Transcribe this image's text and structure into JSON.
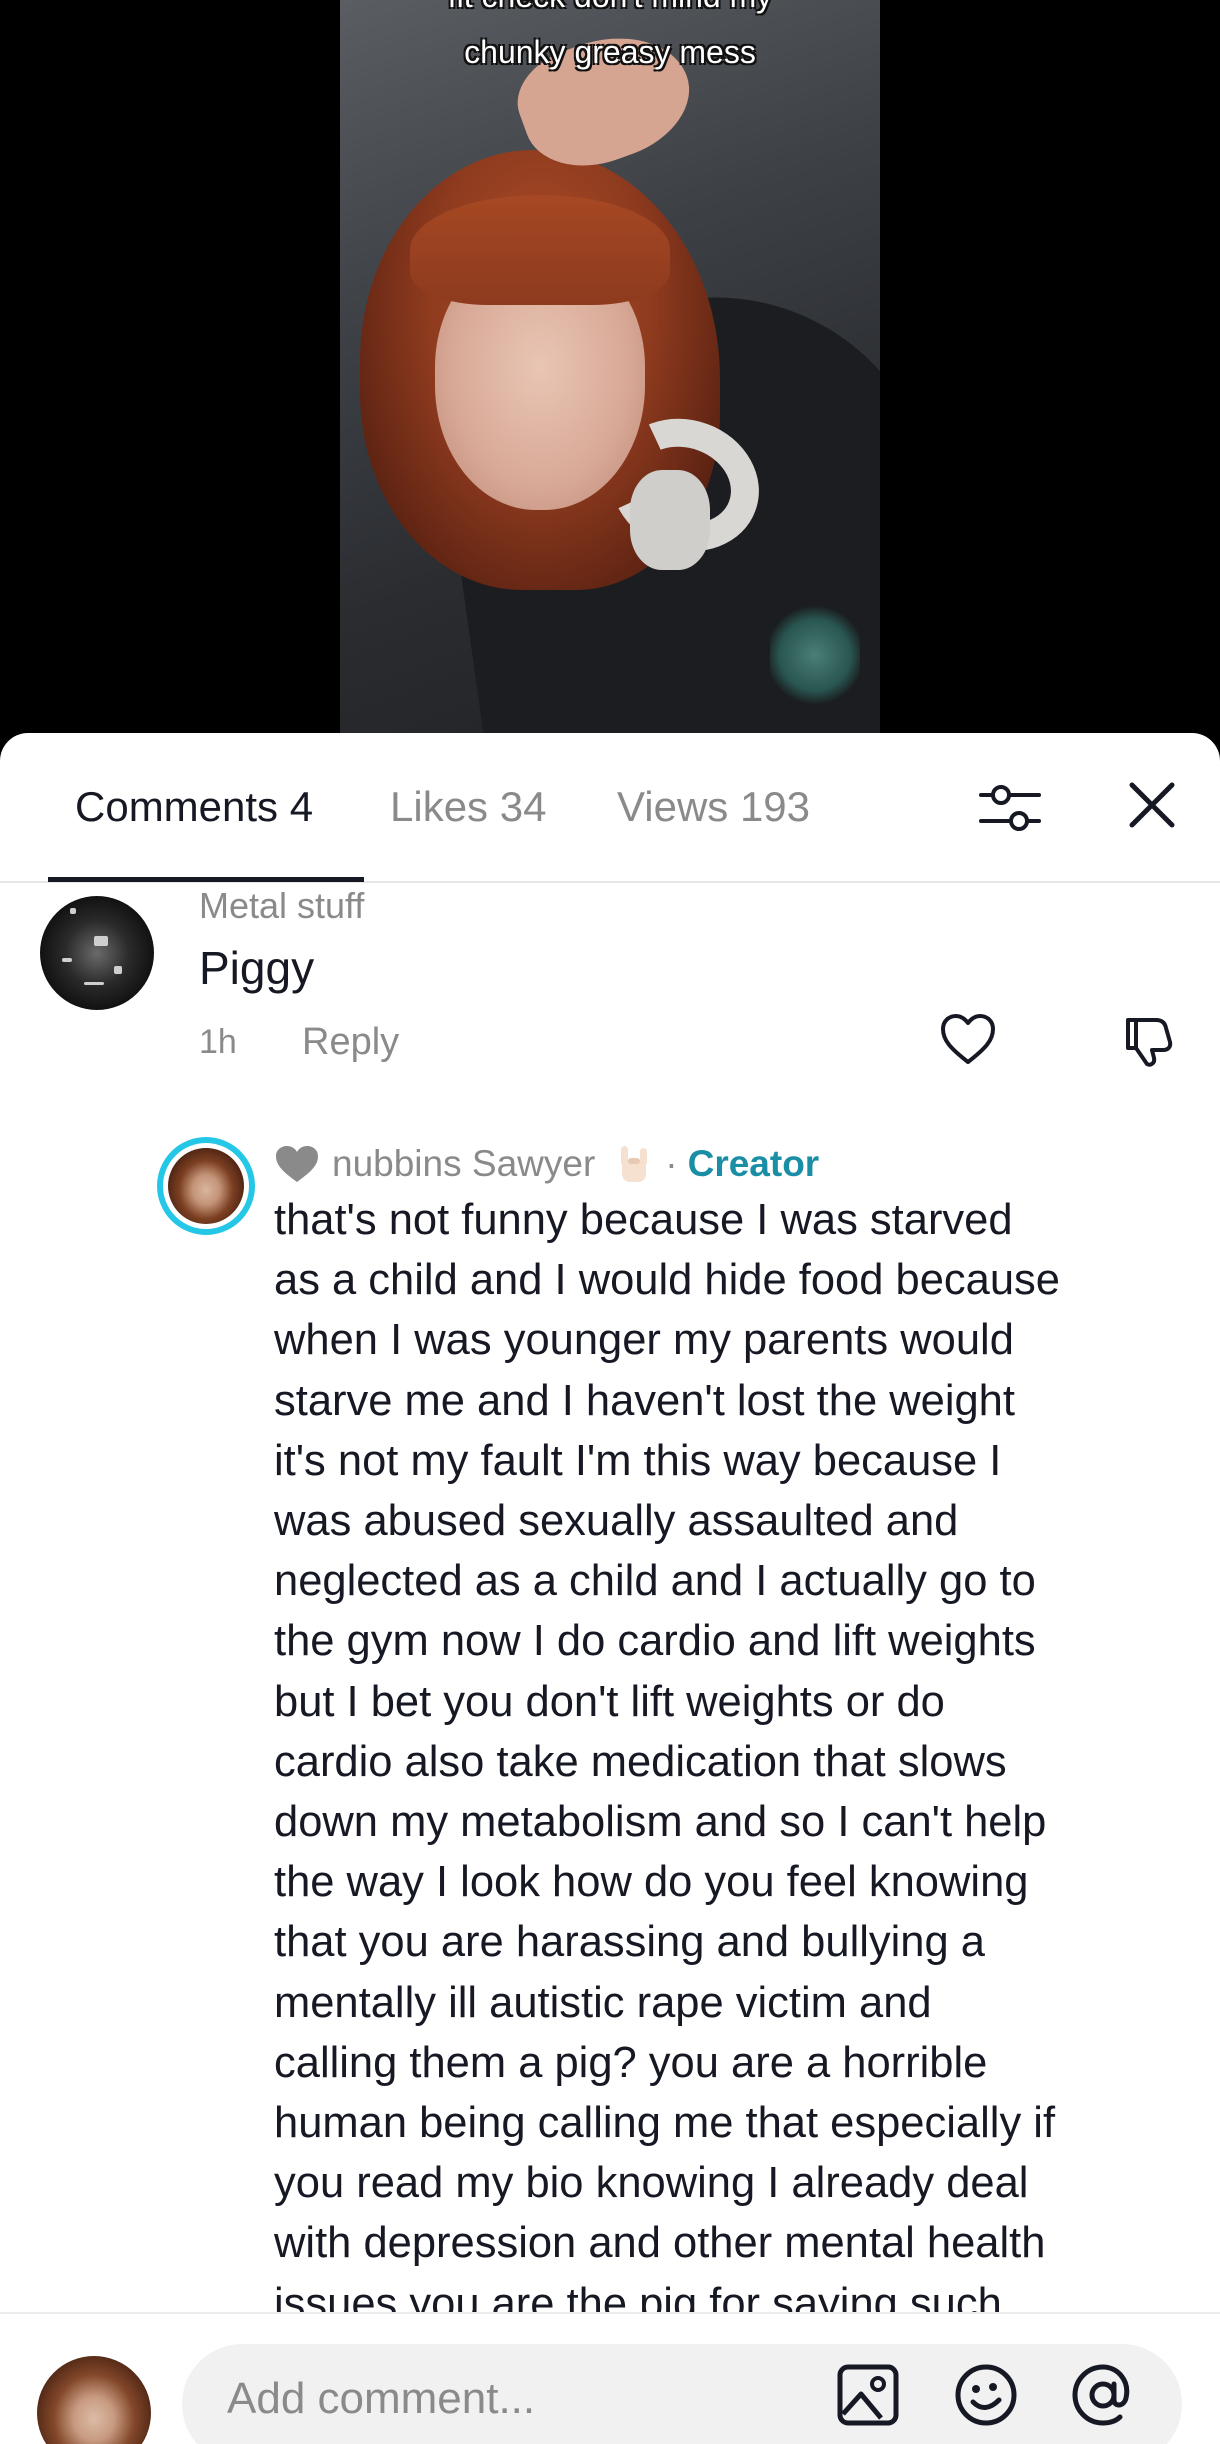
{
  "video": {
    "overlay_line1": "fit check don't mind my",
    "overlay_line2": "chunky greasy mess"
  },
  "tabs": {
    "comments": "Comments 4",
    "likes": "Likes 34",
    "views": "Views 193"
  },
  "icons": {
    "filter": "sliders-icon",
    "close": "close-icon",
    "like": "heart-outline-icon",
    "dislike": "thumbs-down-icon",
    "creator_heart": "heart-filled-icon",
    "horns": "rock-on-hand-emoji",
    "image": "image-icon",
    "emoji": "emoji-icon",
    "mention": "at-sign-icon"
  },
  "comment": {
    "username": "Metal stuff",
    "text": "Piggy",
    "time": "1h",
    "reply_label": "Reply"
  },
  "reply": {
    "username": "nubbins Sawyer",
    "separator": "·",
    "creator_label": "Creator",
    "lines": [
      "that's not funny because I was starved",
      "as a child and I would hide food because",
      "when I was younger my parents would",
      "starve me and I haven't lost the weight",
      "it's not my fault I'm this way because I",
      "was abused sexually assaulted and",
      "neglected as a child and I actually go to",
      "the gym now I do cardio and lift weights",
      "but I bet you don't lift weights or do",
      "cardio also take medication that slows",
      "down my metabolism and so I can't help",
      "the way I look how do you feel knowing",
      "that you are harassing and bullying a",
      "mentally ill autistic rape victim and",
      "calling them a pig? you are a horrible",
      "human being calling me that especially if",
      "you read my bio knowing I already deal",
      "with depression and other mental health",
      "issues you are the pig for saying such"
    ]
  },
  "composer": {
    "placeholder": "Add comment..."
  },
  "colors": {
    "accent_creator": "#1a8ea5",
    "avatar_ring": "#25c7e6",
    "text_primary": "#161823",
    "text_secondary": "#8a8a8a"
  }
}
